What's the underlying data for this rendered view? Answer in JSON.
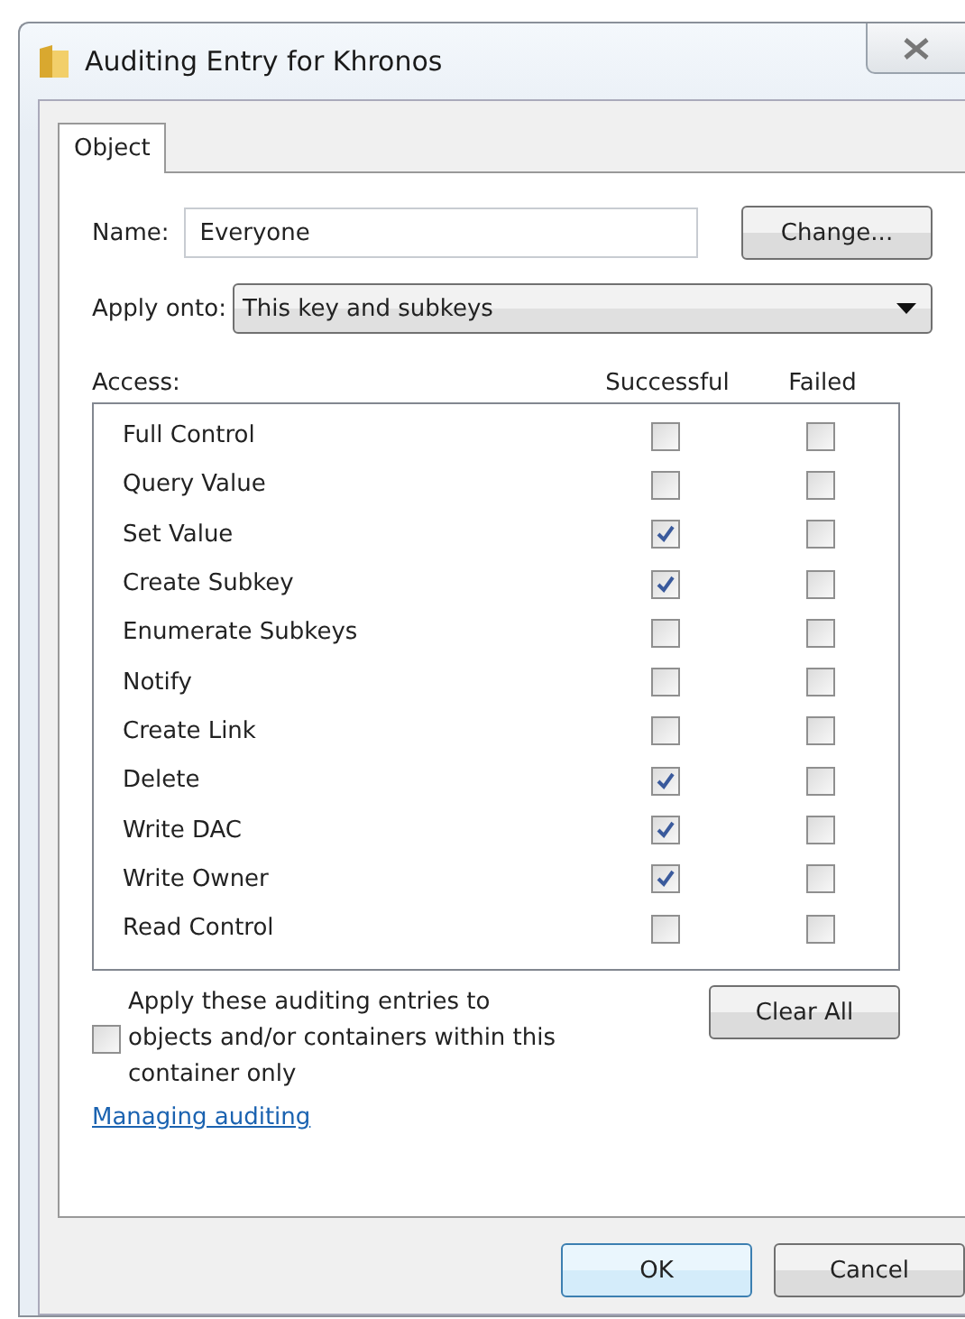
{
  "window": {
    "title": "Auditing Entry for Khronos"
  },
  "tabs": [
    {
      "label": "Object",
      "selected": true
    }
  ],
  "name_field": {
    "label": "Name:",
    "value": "Everyone"
  },
  "change_button": "Change...",
  "apply_onto": {
    "label": "Apply onto:",
    "value": "This key and subkeys"
  },
  "access": {
    "label": "Access:",
    "columns": [
      "Successful",
      "Failed"
    ],
    "rows": [
      {
        "name": "Full Control",
        "successful": false,
        "failed": false
      },
      {
        "name": "Query Value",
        "successful": false,
        "failed": false
      },
      {
        "name": "Set Value",
        "successful": true,
        "failed": false
      },
      {
        "name": "Create Subkey",
        "successful": true,
        "failed": false
      },
      {
        "name": "Enumerate Subkeys",
        "successful": false,
        "failed": false
      },
      {
        "name": "Notify",
        "successful": false,
        "failed": false
      },
      {
        "name": "Create Link",
        "successful": false,
        "failed": false
      },
      {
        "name": "Delete",
        "successful": true,
        "failed": false
      },
      {
        "name": "Write DAC",
        "successful": true,
        "failed": false
      },
      {
        "name": "Write Owner",
        "successful": true,
        "failed": false
      },
      {
        "name": "Read Control",
        "successful": false,
        "failed": false
      }
    ]
  },
  "apply_within": {
    "label": "Apply these auditing entries to objects and/or containers within this container only",
    "checked": false
  },
  "clear_all_button": "Clear All",
  "link": "Managing auditing",
  "buttons": [
    "OK",
    "Cancel"
  ]
}
